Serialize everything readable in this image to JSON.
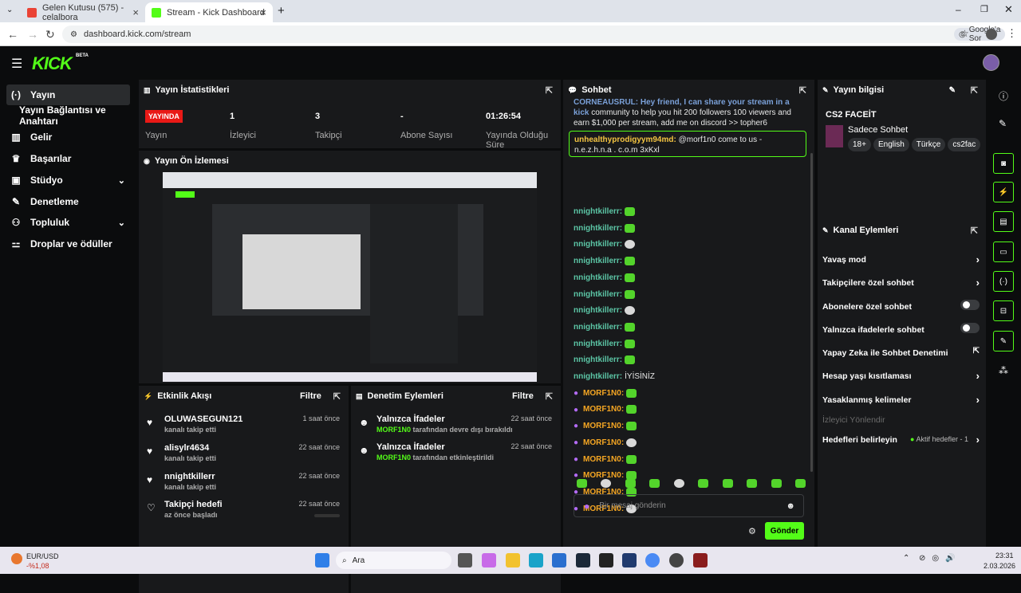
{
  "browser": {
    "tabs": [
      {
        "label": "Gelen Kutusu (575) - celalbora"
      },
      {
        "label": "Stream - Kick Dashboard"
      }
    ],
    "url": "dashboard.kick.com/stream",
    "google_btn": "Google'a Sor"
  },
  "logo": "KICK",
  "beta": "BETA",
  "sidebar": {
    "items": [
      {
        "label": "Yayın"
      },
      {
        "label": "Yayın Bağlantısı ve Anahtarı"
      },
      {
        "label": "Gelir"
      },
      {
        "label": "Başarılar"
      },
      {
        "label": "Stüdyo"
      },
      {
        "label": "Denetleme"
      },
      {
        "label": "Topluluk"
      },
      {
        "label": "Droplar ve ödüller"
      }
    ]
  },
  "stats": {
    "title": "Yayın İstatistikleri",
    "live_badge": "YAYINDA",
    "live_label": "Yayın",
    "viewers_value": "1",
    "viewers_label": "İzleyici",
    "followers_value": "3",
    "followers_label": "Takipçi",
    "subs_value": "-",
    "subs_label": "Abone Sayısı",
    "uptime_value": "01:26:54",
    "uptime_label": "Yayında Olduğu Süre"
  },
  "preview": {
    "title": "Yayın Ön İzlemesi"
  },
  "activity": {
    "title": "Etkinlik Akışı",
    "filter": "Filtre",
    "rows": [
      {
        "name": "OLUWASEGUN121",
        "sub": "kanalı takip etti",
        "time": "1 saat önce"
      },
      {
        "name": "alisylr4634",
        "sub": "kanalı takip etti",
        "time": "22 saat önce"
      },
      {
        "name": "nnightkillerr",
        "sub": "kanalı takip etti",
        "time": "22 saat önce"
      },
      {
        "name": "Takipçi hedefi",
        "sub": "az önce başladı",
        "time": "22 saat önce"
      }
    ]
  },
  "modactions": {
    "title": "Denetim Eylemleri",
    "filter": "Filtre",
    "rows": [
      {
        "name": "Yalnızca İfadeler",
        "by": "MORF1N0",
        "sub": "tarafından devre dışı bırakıldı",
        "time": "22 saat önce"
      },
      {
        "name": "Yalnızca İfadeler",
        "by": "MORF1N0",
        "sub": "tarafından etkinleştirildi",
        "time": "22 saat önce"
      }
    ]
  },
  "chat": {
    "title": "Sohbet",
    "top_msg": "community to help you hit 200 followers 100 viewers and earn $1,000 per stream, add me on discord >> topher6",
    "top_prefix": "CORNEAUSRUL: Hey friend, I can share your stream in a kick",
    "highlight_user": "unhealthyprodigyym94md:",
    "highlight_msg": "@morf1n0 come to us - n.e.z.h.n.a . c.o.m 3xKxl",
    "messages": [
      {
        "user": "nnightkillerr:",
        "text": ""
      },
      {
        "user": "nnightkillerr:",
        "text": ""
      },
      {
        "user": "nnightkillerr:",
        "text": ""
      },
      {
        "user": "nnightkillerr:",
        "text": ""
      },
      {
        "user": "nnightkillerr:",
        "text": ""
      },
      {
        "user": "nnightkillerr:",
        "text": ""
      },
      {
        "user": "nnightkillerr:",
        "text": ""
      },
      {
        "user": "nnightkillerr:",
        "text": ""
      },
      {
        "user": "nnightkillerr:",
        "text": ""
      },
      {
        "user": "nnightkillerr:",
        "text": ""
      },
      {
        "user": "nnightkillerr:",
        "text": "İYİSİNİZ"
      },
      {
        "user": "MORF1N0:",
        "text": ""
      },
      {
        "user": "MORF1N0:",
        "text": ""
      },
      {
        "user": "MORF1N0:",
        "text": ""
      },
      {
        "user": "MORF1N0:",
        "text": ""
      },
      {
        "user": "MORF1N0:",
        "text": ""
      },
      {
        "user": "MORF1N0:",
        "text": ""
      },
      {
        "user": "MORF1N0:",
        "text": ""
      },
      {
        "user": "MORF1N0:",
        "text": ""
      }
    ],
    "input_placeholder": "Bir mesaj gönderin",
    "send": "Gönder"
  },
  "info": {
    "title": "Yayın bilgisi",
    "stream_title": "CS2 FACEİT",
    "category": "Sadece Sohbet",
    "tags": [
      "18+",
      "English",
      "Türkçe",
      "cs2fac"
    ]
  },
  "channel": {
    "title": "Kanal Eylemleri",
    "rows": [
      {
        "label": "Yavaş mod"
      },
      {
        "label": "Takipçilere özel sohbet"
      },
      {
        "label": "Abonelere özel sohbet"
      },
      {
        "label": "Yalnızca ifadelerle sohbet"
      },
      {
        "label": "Yapay Zeka ile Sohbet Denetimi"
      },
      {
        "label": "Hesap yaşı kısıtlaması"
      },
      {
        "label": "Yasaklanmış kelimeler"
      },
      {
        "label": "İzleyici Yönlendir"
      },
      {
        "label": "Hedefleri belirleyin"
      }
    ],
    "active_goals": "Aktif hedefler - 1"
  },
  "taskbar": {
    "ticker": "EUR/USD",
    "change": "-%1,08",
    "search": "Ara",
    "time": "23:31",
    "date": "2.03.2026"
  }
}
